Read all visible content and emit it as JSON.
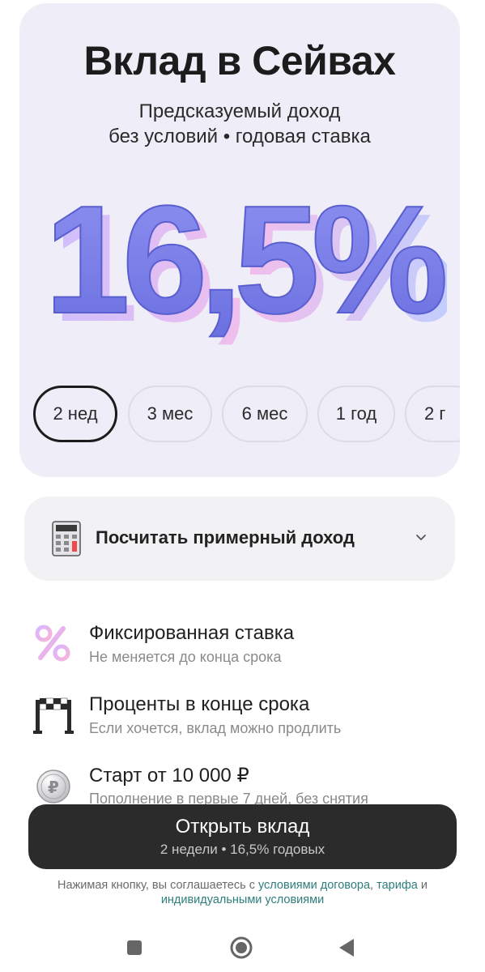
{
  "hero": {
    "title": "Вклад в Сейвах",
    "subtitle_line1": "Предсказуемый доход",
    "subtitle_line2": "без условий • годовая ставка",
    "rate": "16,5%",
    "rate_color": "#7a7ee6",
    "chips": [
      {
        "label": "2 нед",
        "selected": true
      },
      {
        "label": "3 мес",
        "selected": false
      },
      {
        "label": "6 мес",
        "selected": false
      },
      {
        "label": "1 год",
        "selected": false
      },
      {
        "label": "2 г",
        "selected": false
      }
    ]
  },
  "calculator": {
    "label": "Посчитать примерный доход",
    "icon": "calculator-icon"
  },
  "features": [
    {
      "title": "Фиксированная ставка",
      "description": "Не меняется до конца срока",
      "icon": "percent-icon"
    },
    {
      "title": "Проценты в конце срока",
      "description": "Если хочется, вклад можно продлить",
      "icon": "finish-flag-icon"
    },
    {
      "title": "Старт от 10 000 ₽",
      "description": "Пополнение в первые 7 дней, без снятия",
      "icon": "ruble-coin-icon"
    }
  ],
  "cta": {
    "title": "Открыть вклад",
    "subtitle": "2 недели • 16,5% годовых",
    "background": "#2b2b2b"
  },
  "legal": {
    "prefix": "Нажимая кнопку, вы соглашаетесь с ",
    "link1": "условиями договора",
    "sep": ", ",
    "link2": "тарифа",
    "and": " и ",
    "link3": "индивидуальными условиями",
    "link_color": "#2e7d7d"
  },
  "navbar": {
    "recent": "square-icon",
    "home": "circle-icon",
    "back": "triangle-back-icon"
  }
}
